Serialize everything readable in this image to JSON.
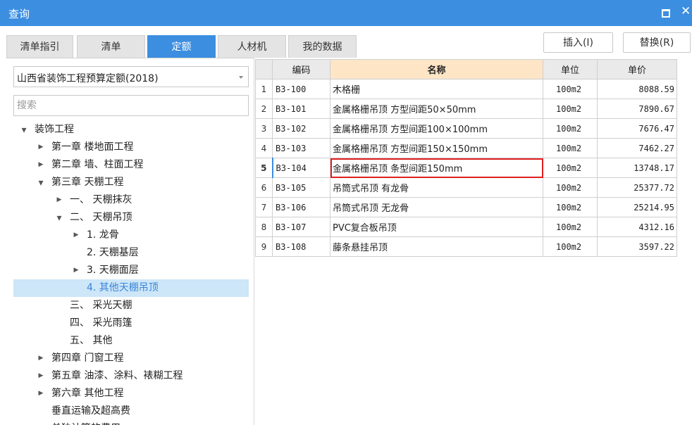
{
  "window": {
    "title": "查询"
  },
  "tabs": [
    "清单指引",
    "清单",
    "定额",
    "人材机",
    "我的数据"
  ],
  "active_tab": "定额",
  "actions": {
    "insert": "插入(I)",
    "replace": "替换(R)"
  },
  "library": {
    "selected": "山西省装饰工程预算定额(2018)"
  },
  "search": {
    "placeholder": "搜索",
    "value": ""
  },
  "tree": [
    {
      "label": "装饰工程",
      "toggle": "▲",
      "level": 0
    },
    {
      "label": "第一章 楼地面工程",
      "toggle": "▶",
      "level": 1
    },
    {
      "label": "第二章 墙、柱面工程",
      "toggle": "▶",
      "level": 1
    },
    {
      "label": "第三章 天棚工程",
      "toggle": "▲",
      "level": 1
    },
    {
      "label": "一、 天棚抹灰",
      "toggle": "▶",
      "level": 2
    },
    {
      "label": "二、 天棚吊顶",
      "toggle": "▲",
      "level": 2
    },
    {
      "label": "1. 龙骨",
      "toggle": "▶",
      "level": 3
    },
    {
      "label": "2. 天棚基层",
      "toggle": "",
      "level": 3
    },
    {
      "label": "3. 天棚面层",
      "toggle": "▶",
      "level": 3
    },
    {
      "label": "4. 其他天棚吊顶",
      "toggle": "",
      "level": 3,
      "selected": true
    },
    {
      "label": "三、 采光天棚",
      "toggle": "",
      "level": 2
    },
    {
      "label": "四、 采光雨篷",
      "toggle": "",
      "level": 2
    },
    {
      "label": "五、 其他",
      "toggle": "",
      "level": 2
    },
    {
      "label": "第四章 门窗工程",
      "toggle": "▶",
      "level": 1
    },
    {
      "label": "第五章 油漆、涂料、裱糊工程",
      "toggle": "▶",
      "level": 1
    },
    {
      "label": "第六章 其他工程",
      "toggle": "▶",
      "level": 1
    },
    {
      "label": "垂直运输及超高费",
      "toggle": "",
      "level": 1
    },
    {
      "label": "单独计算的费用",
      "toggle": "",
      "level": 1
    }
  ],
  "table": {
    "headers": {
      "code": "编码",
      "name": "名称",
      "unit": "单位",
      "price": "单价"
    },
    "current_row": 5,
    "rows": [
      {
        "idx": "1",
        "code": "B3-100",
        "name": "木格栅",
        "unit": "100m2",
        "price": "8088.59"
      },
      {
        "idx": "2",
        "code": "B3-101",
        "name": "金属格栅吊顶 方型间距50×50mm",
        "unit": "100m2",
        "price": "7890.67"
      },
      {
        "idx": "3",
        "code": "B3-102",
        "name": "金属格栅吊顶 方型间距100×100mm",
        "unit": "100m2",
        "price": "7676.47"
      },
      {
        "idx": "4",
        "code": "B3-103",
        "name": "金属格栅吊顶 方型间距150×150mm",
        "unit": "100m2",
        "price": "7462.27"
      },
      {
        "idx": "5",
        "code": "B3-104",
        "name": "金属格栅吊顶 条型间距150mm",
        "unit": "100m2",
        "price": "13748.17"
      },
      {
        "idx": "6",
        "code": "B3-105",
        "name": "吊筒式吊顶 有龙骨",
        "unit": "100m2",
        "price": "25377.72"
      },
      {
        "idx": "7",
        "code": "B3-106",
        "name": "吊筒式吊顶 无龙骨",
        "unit": "100m2",
        "price": "25214.95"
      },
      {
        "idx": "8",
        "code": "B3-107",
        "name": "PVC复合板吊顶",
        "unit": "100m2",
        "price": "4312.16"
      },
      {
        "idx": "9",
        "code": "B3-108",
        "name": "藤条悬挂吊顶",
        "unit": "100m2",
        "price": "3597.22"
      }
    ]
  },
  "colors": {
    "accent": "#3c8ee0",
    "highlight_border": "#e02020",
    "name_header_bg": "#fde5c6",
    "selection_bg": "#cde6f8"
  }
}
